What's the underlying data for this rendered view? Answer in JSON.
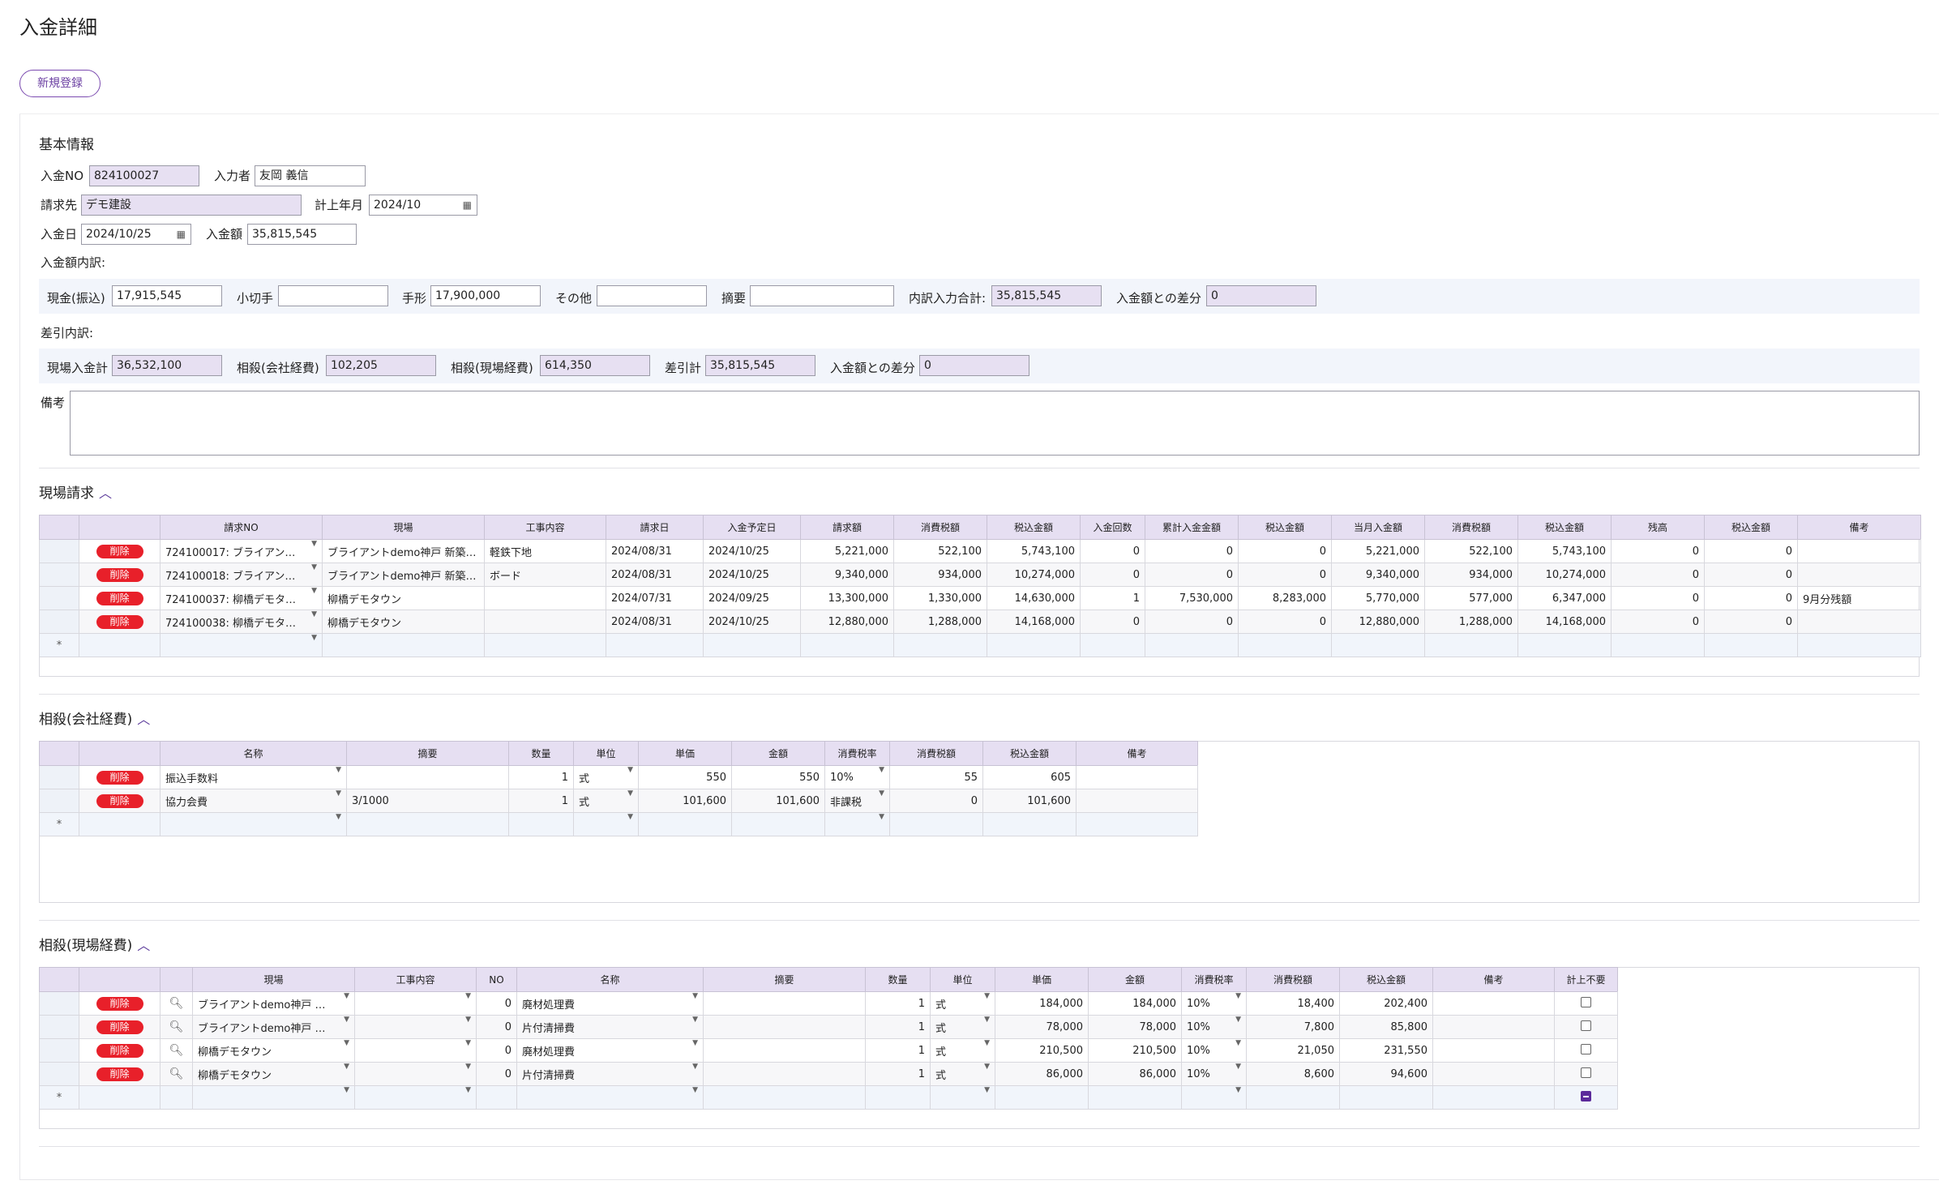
{
  "page": {
    "title": "入金詳細",
    "new_button": "新規登録"
  },
  "basic": {
    "section_title": "基本情報",
    "nyukin_no_label": "入金NO",
    "nyukin_no": "824100027",
    "input_person_label": "入力者",
    "input_person": "友岡 義信",
    "billing_label": "請求先",
    "billing": "デモ建設",
    "posting_month_label": "計上年月",
    "posting_month": "2024/10",
    "date_label": "入金日",
    "date": "2024/10/25",
    "amount_label": "入金額",
    "amount": "35,815,545",
    "breakdown_title": "入金額内訳:",
    "cash_label": "現金(振込)",
    "cash": "17,915,545",
    "check_label": "小切手",
    "check": "",
    "bill_label": "手形",
    "bill": "17,900,000",
    "other_label": "その他",
    "other": "",
    "summary_label": "摘要",
    "summary": "",
    "breakdown_total_label": "内訳入力合計:",
    "breakdown_total": "35,815,545",
    "diff_label": "入金額との差分",
    "diff": "0",
    "deduction_title": "差引内訳:",
    "site_total_label": "現場入金計",
    "site_total": "36,532,100",
    "offset_company_label": "相殺(会社経費)",
    "offset_company": "102,205",
    "offset_site_label": "相殺(現場経費)",
    "offset_site": "614,350",
    "deduction_total_label": "差引計",
    "deduction_total": "35,815,545",
    "diff2_label": "入金額との差分",
    "diff2": "0",
    "remarks_label": "備考",
    "remarks": ""
  },
  "site_billing": {
    "title": "現場請求",
    "headers": [
      "請求NO",
      "現場",
      "工事内容",
      "請求日",
      "入金予定日",
      "請求額",
      "消費税額",
      "税込金額",
      "入金回数",
      "累計入金金額",
      "税込金額",
      "当月入金額",
      "消費税額",
      "税込金額",
      "残高",
      "税込金額",
      "備考"
    ],
    "delete_label": "削除",
    "new_row_mark": "*",
    "rows": [
      [
        "724100017: ブライアン…",
        "ブライアントdemo神戸 新築…",
        "軽鉄下地",
        "2024/08/31",
        "2024/10/25",
        "5,221,000",
        "522,100",
        "5,743,100",
        "0",
        "0",
        "0",
        "5,221,000",
        "522,100",
        "5,743,100",
        "0",
        "0",
        ""
      ],
      [
        "724100018: ブライアン…",
        "ブライアントdemo神戸 新築…",
        "ボード",
        "2024/08/31",
        "2024/10/25",
        "9,340,000",
        "934,000",
        "10,274,000",
        "0",
        "0",
        "0",
        "9,340,000",
        "934,000",
        "10,274,000",
        "0",
        "0",
        ""
      ],
      [
        "724100037: 柳橋デモタ…",
        "柳橋デモタウン",
        "",
        "2024/07/31",
        "2024/09/25",
        "13,300,000",
        "1,330,000",
        "14,630,000",
        "1",
        "7,530,000",
        "8,283,000",
        "5,770,000",
        "577,000",
        "6,347,000",
        "0",
        "0",
        "9月分残額"
      ],
      [
        "724100038: 柳橋デモタ…",
        "柳橋デモタウン",
        "",
        "2024/08/31",
        "2024/10/25",
        "12,880,000",
        "1,288,000",
        "14,168,000",
        "0",
        "0",
        "0",
        "12,880,000",
        "1,288,000",
        "14,168,000",
        "0",
        "0",
        ""
      ]
    ]
  },
  "offset_company": {
    "title": "相殺(会社経費)",
    "headers": [
      "名称",
      "摘要",
      "数量",
      "単位",
      "単価",
      "金額",
      "消費税率",
      "消費税額",
      "税込金額",
      "備考"
    ],
    "delete_label": "削除",
    "new_row_mark": "*",
    "rows": [
      [
        "振込手数料",
        "",
        "1",
        "式",
        "550",
        "550",
        "10%",
        "55",
        "605",
        ""
      ],
      [
        "協力会費",
        "3/1000",
        "1",
        "式",
        "101,600",
        "101,600",
        "非課税",
        "0",
        "101,600",
        ""
      ]
    ]
  },
  "offset_site": {
    "title": "相殺(現場経費)",
    "headers": [
      "現場",
      "工事内容",
      "NO",
      "名称",
      "摘要",
      "数量",
      "単位",
      "単価",
      "金額",
      "消費税率",
      "消費税額",
      "税込金額",
      "備考",
      "計上不要"
    ],
    "delete_label": "削除",
    "new_row_mark": "*",
    "rows": [
      [
        "ブライアントdemo神戸 …",
        "",
        "0",
        "廃材処理費",
        "",
        "1",
        "式",
        "184,000",
        "184,000",
        "10%",
        "18,400",
        "202,400",
        ""
      ],
      [
        "ブライアントdemo神戸 …",
        "",
        "0",
        "片付清掃費",
        "",
        "1",
        "式",
        "78,000",
        "78,000",
        "10%",
        "7,800",
        "85,800",
        ""
      ],
      [
        "柳橋デモタウン",
        "",
        "0",
        "廃材処理費",
        "",
        "1",
        "式",
        "210,500",
        "210,500",
        "10%",
        "21,050",
        "231,550",
        ""
      ],
      [
        "柳橋デモタウン",
        "",
        "0",
        "片付清掃費",
        "",
        "1",
        "式",
        "86,000",
        "86,000",
        "10%",
        "8,600",
        "94,600",
        ""
      ]
    ]
  }
}
